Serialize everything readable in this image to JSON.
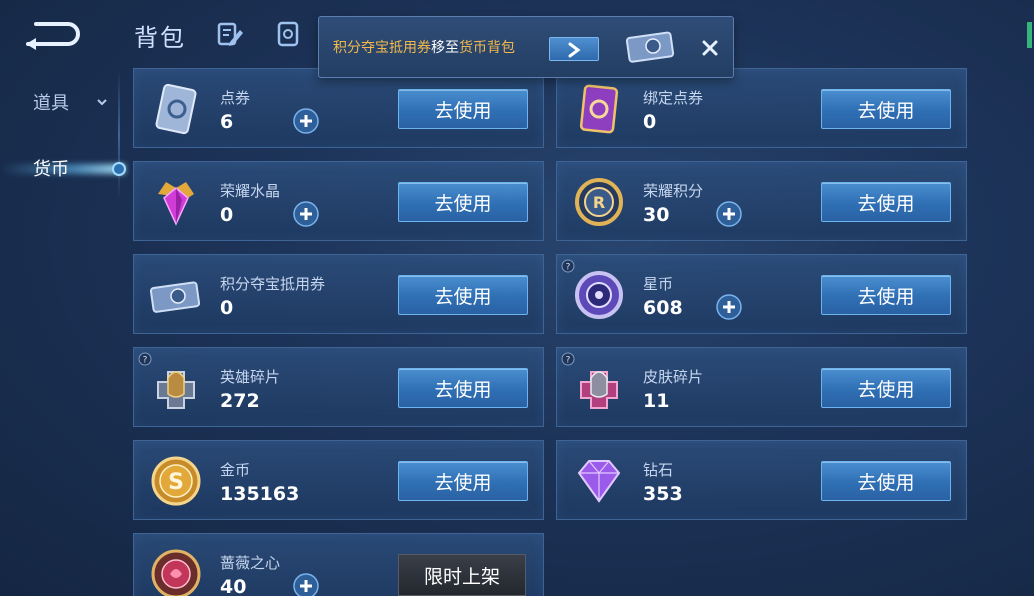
{
  "header": {
    "title": "背包"
  },
  "sidebar": {
    "items": [
      {
        "label": "道具"
      },
      {
        "label": "货币"
      }
    ]
  },
  "toast": {
    "part1": "积分夺宝抵用券",
    "part2": "移至",
    "part3": "货币背包"
  },
  "cards": [
    {
      "name": "点券",
      "count": "6",
      "button": "去使用"
    },
    {
      "name": "绑定点券",
      "count": "0",
      "button": "去使用"
    },
    {
      "name": "荣耀水晶",
      "count": "0",
      "button": "去使用"
    },
    {
      "name": "荣耀积分",
      "count": "30",
      "button": "去使用"
    },
    {
      "name": "积分夺宝抵用券",
      "count": "0",
      "button": "去使用"
    },
    {
      "name": "星币",
      "count": "608",
      "button": "去使用"
    },
    {
      "name": "英雄碎片",
      "count": "272",
      "button": "去使用"
    },
    {
      "name": "皮肤碎片",
      "count": "11",
      "button": "去使用"
    },
    {
      "name": "金币",
      "count": "135163",
      "button": "去使用"
    },
    {
      "name": "钻石",
      "count": "353",
      "button": "去使用"
    },
    {
      "name": "蔷薇之心",
      "count": "40",
      "button": "限时上架"
    }
  ],
  "colors": {
    "accent": "#f1b949",
    "button": "#3a7cc2",
    "background": "#1c3257"
  }
}
